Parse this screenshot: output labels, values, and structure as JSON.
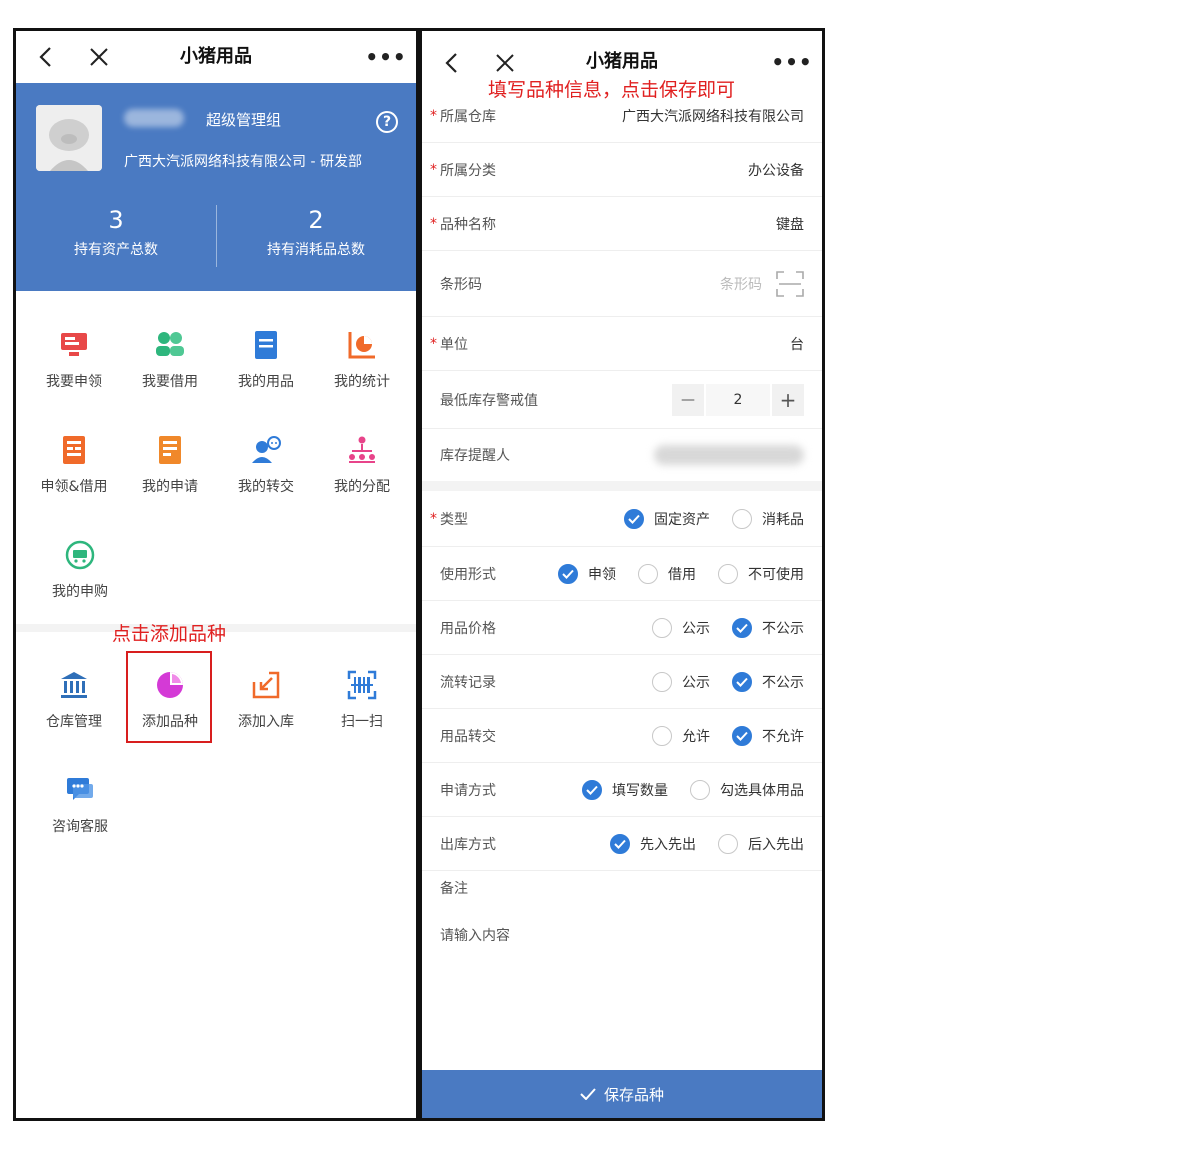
{
  "left": {
    "nav": {
      "title": "小猪用品",
      "more": "•••"
    },
    "profile": {
      "role": "超级管理组",
      "org": "广西大汽派网络科技有限公司 - 研发部",
      "stats": [
        {
          "num": "3",
          "label": "持有资产总数"
        },
        {
          "num": "2",
          "label": "持有消耗品总数"
        }
      ]
    },
    "grid1": [
      {
        "label": "我要申领",
        "icon": "apply-icon",
        "color": "#e84848"
      },
      {
        "label": "我要借用",
        "icon": "borrow-icon",
        "color": "#2eb67d"
      },
      {
        "label": "我的用品",
        "icon": "document-icon",
        "color": "#2f7bd8"
      },
      {
        "label": "我的统计",
        "icon": "pie-chart-icon",
        "color": "#f06a2a"
      },
      {
        "label": "申领&借用",
        "icon": "form-icon",
        "color": "#f06a2a"
      },
      {
        "label": "我的申请",
        "icon": "request-icon",
        "color": "#f0882a"
      },
      {
        "label": "我的转交",
        "icon": "transfer-icon",
        "color": "#2f7bd8"
      },
      {
        "label": "我的分配",
        "icon": "allocate-icon",
        "color": "#e8448a"
      },
      {
        "label": "我的申购",
        "icon": "cart-icon",
        "color": "#2eb67d"
      }
    ],
    "annotation": "点击添加品种",
    "grid2": [
      {
        "label": "仓库管理",
        "icon": "warehouse-icon",
        "color": "#2f6fb8"
      },
      {
        "label": "添加品种",
        "icon": "pie-icon",
        "color": "#d43ad6"
      },
      {
        "label": "添加入库",
        "icon": "import-icon",
        "color": "#f06a2a"
      },
      {
        "label": "扫一扫",
        "icon": "scan-icon",
        "color": "#2f7bd8"
      },
      {
        "label": "咨询客服",
        "icon": "chat-icon",
        "color": "#2f7bd8"
      }
    ]
  },
  "right": {
    "nav": {
      "title": "小猪用品",
      "more": "•••"
    },
    "annotation": "填写品种信息，点击保存即可",
    "required_mark": "*",
    "fields": {
      "warehouse": {
        "label": "所属仓库",
        "value": "广西大汽派网络科技有限公司"
      },
      "category": {
        "label": "所属分类",
        "value": "办公设备"
      },
      "name": {
        "label": "品种名称",
        "value": "键盘"
      },
      "barcode": {
        "label": "条形码",
        "placeholder": "条形码"
      },
      "unit": {
        "label": "单位",
        "value": "台"
      },
      "min_stock": {
        "label": "最低库存警戒值",
        "value": "2",
        "minus": "—",
        "plus": "+"
      },
      "reminder": {
        "label": "库存提醒人"
      }
    },
    "options": [
      {
        "key": "type",
        "label": "类型",
        "required": true,
        "choices": [
          {
            "text": "固定资产",
            "checked": true
          },
          {
            "text": "消耗品",
            "checked": false
          }
        ]
      },
      {
        "key": "usage",
        "label": "使用形式",
        "required": false,
        "choices": [
          {
            "text": "申领",
            "checked": true
          },
          {
            "text": "借用",
            "checked": false
          },
          {
            "text": "不可使用",
            "checked": false
          }
        ]
      },
      {
        "key": "price",
        "label": "用品价格",
        "required": false,
        "choices": [
          {
            "text": "公示",
            "checked": false
          },
          {
            "text": "不公示",
            "checked": true
          }
        ]
      },
      {
        "key": "flow",
        "label": "流转记录",
        "required": false,
        "choices": [
          {
            "text": "公示",
            "checked": false
          },
          {
            "text": "不公示",
            "checked": true
          }
        ]
      },
      {
        "key": "handover",
        "label": "用品转交",
        "required": false,
        "choices": [
          {
            "text": "允许",
            "checked": false
          },
          {
            "text": "不允许",
            "checked": true
          }
        ]
      },
      {
        "key": "apply_mode",
        "label": "申请方式",
        "required": false,
        "choices": [
          {
            "text": "填写数量",
            "checked": true
          },
          {
            "text": "勾选具体用品",
            "checked": false
          }
        ]
      },
      {
        "key": "outbound",
        "label": "出库方式",
        "required": false,
        "choices": [
          {
            "text": "先入先出",
            "checked": true
          },
          {
            "text": "后入先出",
            "checked": false
          }
        ]
      }
    ],
    "remark": {
      "label": "备注",
      "placeholder": "请输入内容"
    },
    "save_label": "保存品种"
  }
}
